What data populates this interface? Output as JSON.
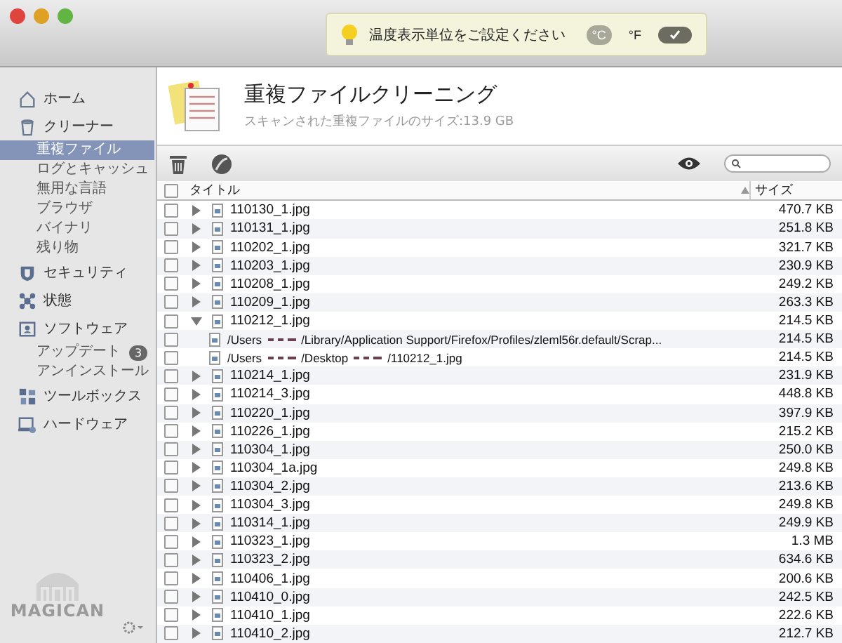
{
  "notification": {
    "message": "温度表示単位をご設定ください",
    "units": [
      {
        "label": "°C",
        "selected": true
      },
      {
        "label": "°F",
        "selected": false
      }
    ]
  },
  "sidebar": {
    "items": [
      {
        "label": "ホーム"
      },
      {
        "label": "クリーナー",
        "children": [
          {
            "label": "重複ファイル",
            "selected": true
          },
          {
            "label": "ログとキャッシュ",
            "selected": false
          },
          {
            "label": "無用な言語",
            "selected": false
          },
          {
            "label": "ブラウザ",
            "selected": false
          },
          {
            "label": "バイナリ",
            "selected": false
          },
          {
            "label": "残り物",
            "selected": false
          }
        ]
      },
      {
        "label": "セキュリティ"
      },
      {
        "label": "状態"
      },
      {
        "label": "ソフトウェア",
        "children": [
          {
            "label": "アップデート",
            "selected": false,
            "badge": "3"
          },
          {
            "label": "アンインストール",
            "selected": false
          }
        ]
      },
      {
        "label": "ツールボックス"
      },
      {
        "label": "ハードウェア"
      }
    ],
    "logo": "MAGICAN"
  },
  "header": {
    "title": "重複ファイルクリーニング",
    "subtitle": "スキャンされた重複ファイルのサイズ:13.9 GB"
  },
  "table": {
    "select_all_checked": false,
    "columns": [
      "タイトル",
      "サイズ"
    ],
    "rows": [
      {
        "title": "110130_1.jpg",
        "size": "470.7 KB",
        "checked": false,
        "expanded": false
      },
      {
        "title": "110131_1.jpg",
        "size": "251.8 KB",
        "checked": false,
        "expanded": false
      },
      {
        "title": "110202_1.jpg",
        "size": "321.7 KB",
        "checked": false,
        "expanded": false
      },
      {
        "title": "110203_1.jpg",
        "size": "230.9 KB",
        "checked": false,
        "expanded": false
      },
      {
        "title": "110208_1.jpg",
        "size": "249.2 KB",
        "checked": false,
        "expanded": false
      },
      {
        "title": "110209_1.jpg",
        "size": "263.3 KB",
        "checked": false,
        "expanded": false
      },
      {
        "title": "110212_1.jpg",
        "size": "214.5 KB",
        "checked": false,
        "expanded": true,
        "children": [
          {
            "segments": [
              "/Users",
              "/Library/Application Support/Firefox/Profiles/zleml56r.default/Scrap..."
            ],
            "size": "214.5 KB",
            "checked": false
          },
          {
            "segments": [
              "/Users",
              "/Desktop",
              "/110212_1.jpg"
            ],
            "size": "214.5 KB",
            "checked": false
          }
        ]
      },
      {
        "title": "110214_1.jpg",
        "size": "231.9 KB",
        "checked": false,
        "expanded": false
      },
      {
        "title": "110214_3.jpg",
        "size": "448.8 KB",
        "checked": false,
        "expanded": false
      },
      {
        "title": "110220_1.jpg",
        "size": "397.9 KB",
        "checked": false,
        "expanded": false
      },
      {
        "title": "110226_1.jpg",
        "size": "215.2 KB",
        "checked": false,
        "expanded": false
      },
      {
        "title": "110304_1.jpg",
        "size": "250.0 KB",
        "checked": false,
        "expanded": false
      },
      {
        "title": "110304_1a.jpg",
        "size": "249.8 KB",
        "checked": false,
        "expanded": false
      },
      {
        "title": "110304_2.jpg",
        "size": "213.6 KB",
        "checked": false,
        "expanded": false
      },
      {
        "title": "110304_3.jpg",
        "size": "249.8 KB",
        "checked": false,
        "expanded": false
      },
      {
        "title": "110314_1.jpg",
        "size": "249.9 KB",
        "checked": false,
        "expanded": false
      },
      {
        "title": "110323_1.jpg",
        "size": "1.3 MB",
        "checked": false,
        "expanded": false
      },
      {
        "title": "110323_2.jpg",
        "size": "634.6 KB",
        "checked": false,
        "expanded": false
      },
      {
        "title": "110406_1.jpg",
        "size": "200.6 KB",
        "checked": false,
        "expanded": false
      },
      {
        "title": "110410_0.jpg",
        "size": "242.5 KB",
        "checked": false,
        "expanded": false
      },
      {
        "title": "110410_1.jpg",
        "size": "222.6 KB",
        "checked": false,
        "expanded": false
      },
      {
        "title": "110410_2.jpg",
        "size": "212.7 KB",
        "checked": false,
        "expanded": false
      }
    ]
  }
}
